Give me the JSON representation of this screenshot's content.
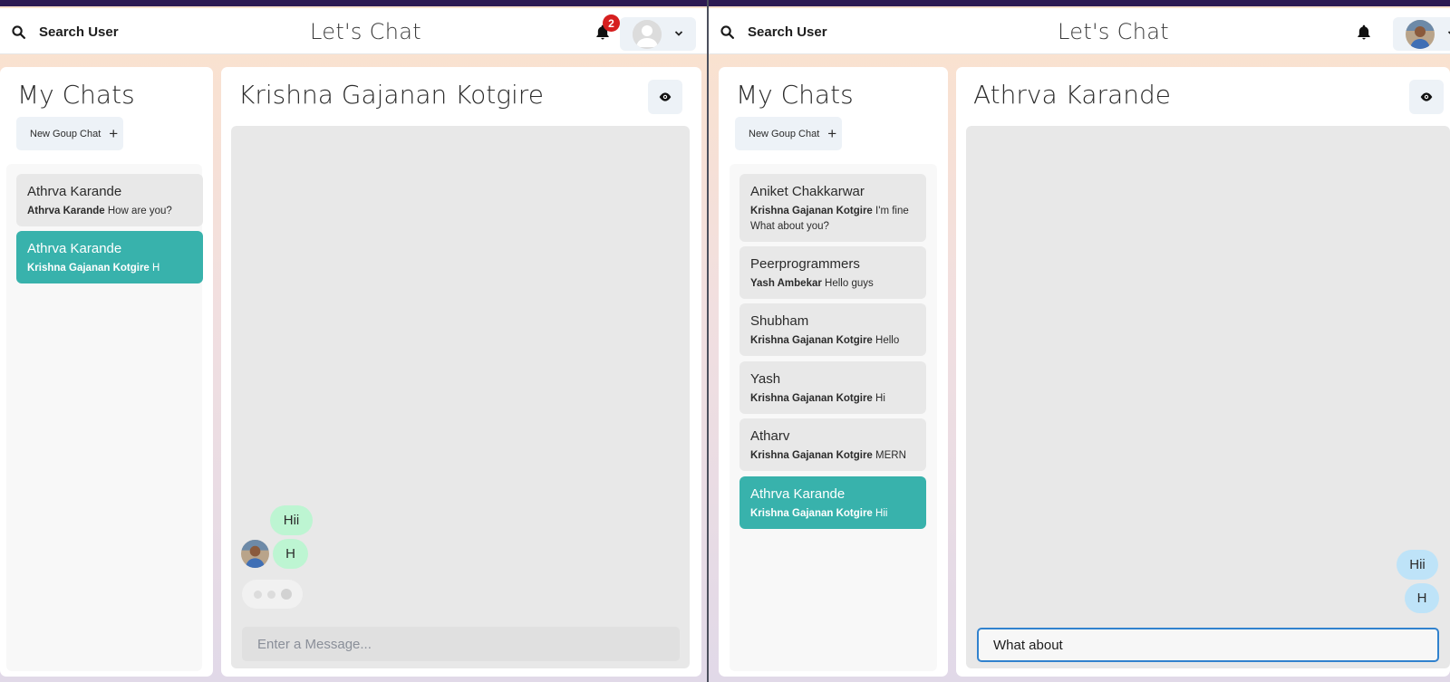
{
  "left": {
    "header": {
      "search_label": "Search User",
      "app_title": "Let's Chat",
      "notification_count": "2"
    },
    "my_chats": {
      "title": "My Chats",
      "new_group_label": "New Goup Chat",
      "items": [
        {
          "name": "Athrva Karande",
          "sender": "Athrva Karande",
          "message": "How are you?",
          "active": false
        },
        {
          "name": "Athrva Karande",
          "sender": "Krishna Gajanan Kotgire",
          "message": "H",
          "active": true
        }
      ]
    },
    "chat": {
      "title": "Krishna Gajanan Kotgire",
      "messages": [
        {
          "text": "Hii",
          "side": "received"
        },
        {
          "text": "H",
          "side": "received"
        }
      ],
      "input_placeholder": "Enter a Message...",
      "input_value": ""
    }
  },
  "right": {
    "header": {
      "search_label": "Search User",
      "app_title": "Let's Chat"
    },
    "my_chats": {
      "title": "My Chats",
      "new_group_label": "New Goup Chat",
      "items": [
        {
          "name": "Aniket Chakkarwar",
          "sender": "Krishna Gajanan Kotgire",
          "message": "I'm fine What about you?",
          "active": false
        },
        {
          "name": "Peerprogrammers",
          "sender": "Yash Ambekar",
          "message": "Hello guys",
          "active": false
        },
        {
          "name": "Shubham",
          "sender": "Krishna Gajanan Kotgire",
          "message": "Hello",
          "active": false
        },
        {
          "name": "Yash",
          "sender": "Krishna Gajanan Kotgire",
          "message": "Hi",
          "active": false
        },
        {
          "name": "Atharv",
          "sender": "Krishna Gajanan Kotgire",
          "message": "MERN",
          "active": false
        },
        {
          "name": "Athrva Karande",
          "sender": "Krishna Gajanan Kotgire",
          "message": "Hii",
          "active": true
        }
      ]
    },
    "chat": {
      "title": "Athrva Karande",
      "messages": [
        {
          "text": "Hii",
          "side": "sent"
        },
        {
          "text": "H",
          "side": "sent"
        }
      ],
      "input_value": "What about"
    }
  },
  "icons": {
    "search": "search-icon",
    "bell": "bell-icon",
    "chevron": "chevron-down-icon",
    "eye": "eye-icon",
    "plus": "plus-icon"
  },
  "colors": {
    "accent": "#38b2ac",
    "sent_bubble": "#bee3f8",
    "received_bubble": "#bdf5d2",
    "badge": "#d61f1f",
    "topbar": "#2d1a52"
  }
}
